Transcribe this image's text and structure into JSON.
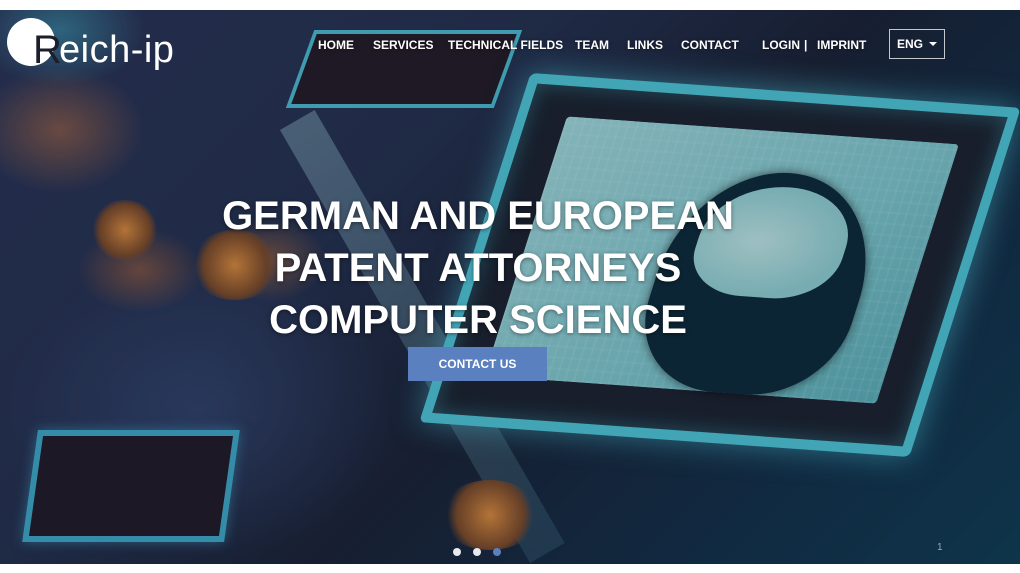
{
  "brand": {
    "logo_letter": "R",
    "logo_text": "eich-ip"
  },
  "nav": {
    "items": [
      {
        "label": "HOME"
      },
      {
        "label": "SERVICES"
      },
      {
        "label": "TECHNICAL FIELDS"
      },
      {
        "label": "TEAM"
      },
      {
        "label": "LINKS"
      },
      {
        "label": "CONTACT"
      },
      {
        "label": "LOGIN"
      },
      {
        "label": "IMPRINT"
      }
    ],
    "separator": "|",
    "language": {
      "selected": "ENG"
    }
  },
  "hero": {
    "headline_lines": [
      "GERMAN AND EUROPEAN",
      "PATENT ATTORNEYS",
      "COMPUTER SCIENCE"
    ],
    "cta_label": "CONTACT US",
    "carousel": {
      "slide_count": 3,
      "active_index": 2,
      "slide_number_text": "1"
    }
  },
  "colors": {
    "accent": "#5b80c0",
    "text": "#ffffff"
  }
}
